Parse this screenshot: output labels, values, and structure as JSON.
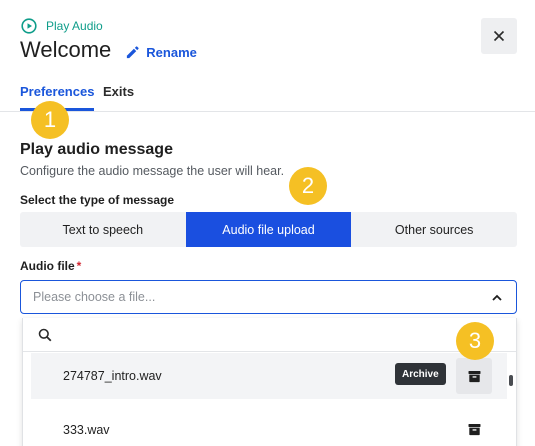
{
  "header": {
    "node_type": "Play Audio",
    "title": "Welcome",
    "rename_label": "Rename"
  },
  "tabs": [
    {
      "label": "Preferences",
      "active": true
    },
    {
      "label": "Exits",
      "active": false
    }
  ],
  "badges": [
    "1",
    "2",
    "3"
  ],
  "section": {
    "title": "Play audio message",
    "description": "Configure the audio message the user will hear."
  },
  "message_type": {
    "label": "Select the type of message",
    "options": [
      "Text to speech",
      "Audio file upload",
      "Other sources"
    ],
    "selected": "Audio file upload"
  },
  "audio_file": {
    "label": "Audio file",
    "required_mark": "*",
    "placeholder": "Please choose a file...",
    "files": [
      {
        "name": "274787_intro.wav"
      },
      {
        "name": "333.wav"
      }
    ],
    "tooltip": "Archive"
  },
  "colors": {
    "accent": "#1a56db",
    "teal": "#0f9d8a",
    "badge": "#f5c024",
    "required": "#d1242f"
  },
  "icons": [
    "play-circle-icon",
    "pencil-icon",
    "close-icon",
    "search-icon",
    "chevron-up-icon",
    "archive-icon"
  ]
}
